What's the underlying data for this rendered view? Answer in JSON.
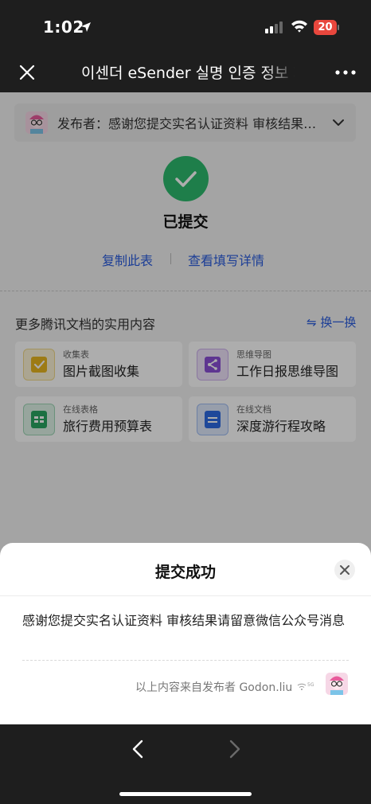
{
  "status_bar": {
    "time": "1:02",
    "battery": "20"
  },
  "nav": {
    "title": "이센더 eSender 실명 인증 정보 제출"
  },
  "publisher_bar": {
    "text": "发布者：感谢您提交实名认证资料 审核结果请留意微信公众号消息"
  },
  "result": {
    "status": "已提交",
    "copy_link": "复制此表",
    "view_link": "查看填写详情"
  },
  "more": {
    "title": "更多腾讯文档的实用内容",
    "swap_label": "⇋ 换一换",
    "cards": [
      {
        "category": "收集表",
        "title": "图片截图收集",
        "icon": "collect-form-icon",
        "color": "#e8b520"
      },
      {
        "category": "思维导图",
        "title": "工作日报思维导图",
        "icon": "mindmap-icon",
        "color": "#8b4fd6"
      },
      {
        "category": "在线表格",
        "title": "旅行费用预算表",
        "icon": "sheet-icon",
        "color": "#2aa562"
      },
      {
        "category": "在线文档",
        "title": "深度游行程攻略",
        "icon": "doc-icon",
        "color": "#2d6ae3"
      }
    ]
  },
  "sheet": {
    "title": "提交成功",
    "message": "感谢您提交实名认证资料 审核结果请留意微信公众号消息",
    "source": "以上内容来自发布者 Godon.liu"
  }
}
